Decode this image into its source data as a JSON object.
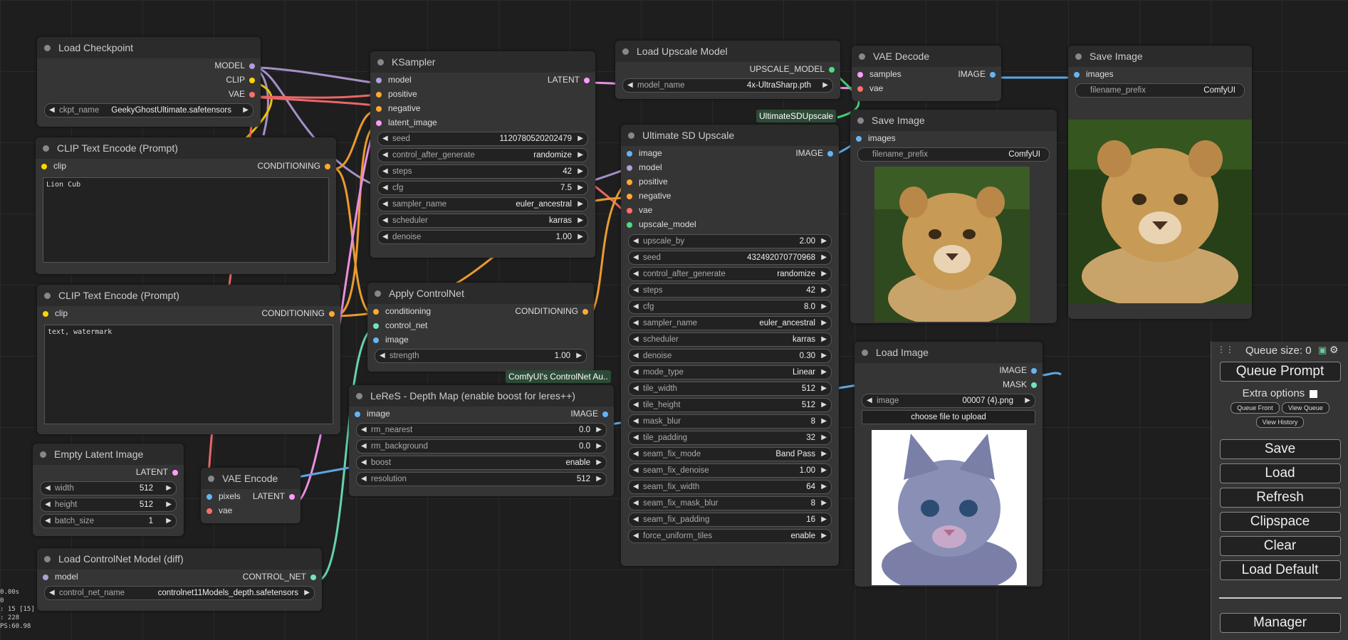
{
  "colors": {
    "model": "#b39ddb",
    "clip": "#ffd500",
    "vae": "#ff6e6e",
    "conditioning": "#ffa931",
    "latent": "#ff9cf9",
    "image": "#64b5f6",
    "control_net": "#6ee7b7",
    "upscale_model": "#4ade80"
  },
  "nodes": {
    "load_checkpoint": {
      "title": "Load Checkpoint",
      "out_model": "MODEL",
      "out_clip": "CLIP",
      "out_vae": "VAE",
      "ckpt_label": "ckpt_name",
      "ckpt_value": "GeekyGhostUltimate.safetensors"
    },
    "clip_pos": {
      "title": "CLIP Text Encode (Prompt)",
      "in_clip": "clip",
      "out": "CONDITIONING",
      "text": "Lion Cub"
    },
    "clip_neg": {
      "title": "CLIP Text Encode (Prompt)",
      "in_clip": "clip",
      "out": "CONDITIONING",
      "text": "text, watermark"
    },
    "empty_latent": {
      "title": "Empty Latent Image",
      "out": "LATENT",
      "widgets": [
        {
          "label": "width",
          "value": "512"
        },
        {
          "label": "height",
          "value": "512"
        },
        {
          "label": "batch_size",
          "value": "1"
        }
      ]
    },
    "vae_encode": {
      "title": "VAE Encode",
      "in_pixels": "pixels",
      "in_vae": "vae",
      "out": "LATENT"
    },
    "load_controlnet": {
      "title": "Load ControlNet Model (diff)",
      "in_model": "model",
      "out": "CONTROL_NET",
      "cn_label": "control_net_name",
      "cn_value": "controlnet11Models_depth.safetensors"
    },
    "ksampler": {
      "title": "KSampler",
      "inputs": [
        "model",
        "positive",
        "negative",
        "latent_image"
      ],
      "out": "LATENT",
      "widgets": [
        {
          "label": "seed",
          "value": "1120780520202479"
        },
        {
          "label": "control_after_generate",
          "value": "randomize"
        },
        {
          "label": "steps",
          "value": "42"
        },
        {
          "label": "cfg",
          "value": "7.5"
        },
        {
          "label": "sampler_name",
          "value": "euler_ancestral"
        },
        {
          "label": "scheduler",
          "value": "karras"
        },
        {
          "label": "denoise",
          "value": "1.00"
        }
      ]
    },
    "apply_controlnet": {
      "title": "Apply ControlNet",
      "inputs": [
        "conditioning",
        "control_net",
        "image"
      ],
      "out": "CONDITIONING",
      "strength_label": "strength",
      "strength_value": "1.00",
      "badge": "ComfyUI's ControlNet Au.."
    },
    "leres": {
      "title": "LeReS - Depth Map (enable boost for leres++)",
      "in_image": "image",
      "out": "IMAGE",
      "widgets": [
        {
          "label": "rm_nearest",
          "value": "0.0"
        },
        {
          "label": "rm_background",
          "value": "0.0"
        },
        {
          "label": "boost",
          "value": "enable"
        },
        {
          "label": "resolution",
          "value": "512"
        }
      ]
    },
    "load_upscale": {
      "title": "Load Upscale Model",
      "out": "UPSCALE_MODEL",
      "model_label": "model_name",
      "model_value": "4x-UltraSharp.pth"
    },
    "ultimate": {
      "title": "Ultimate SD Upscale",
      "inputs": [
        "image",
        "model",
        "positive",
        "negative",
        "vae",
        "upscale_model"
      ],
      "out": "IMAGE",
      "badge": "UltimateSDUpscale",
      "widgets": [
        {
          "label": "upscale_by",
          "value": "2.00"
        },
        {
          "label": "seed",
          "value": "432492070770968"
        },
        {
          "label": "control_after_generate",
          "value": "randomize"
        },
        {
          "label": "steps",
          "value": "42"
        },
        {
          "label": "cfg",
          "value": "8.0"
        },
        {
          "label": "sampler_name",
          "value": "euler_ancestral"
        },
        {
          "label": "scheduler",
          "value": "karras"
        },
        {
          "label": "denoise",
          "value": "0.30"
        },
        {
          "label": "mode_type",
          "value": "Linear"
        },
        {
          "label": "tile_width",
          "value": "512"
        },
        {
          "label": "tile_height",
          "value": "512"
        },
        {
          "label": "mask_blur",
          "value": "8"
        },
        {
          "label": "tile_padding",
          "value": "32"
        },
        {
          "label": "seam_fix_mode",
          "value": "Band Pass"
        },
        {
          "label": "seam_fix_denoise",
          "value": "1.00"
        },
        {
          "label": "seam_fix_width",
          "value": "64"
        },
        {
          "label": "seam_fix_mask_blur",
          "value": "8"
        },
        {
          "label": "seam_fix_padding",
          "value": "16"
        },
        {
          "label": "force_uniform_tiles",
          "value": "enable"
        }
      ]
    },
    "vae_decode": {
      "title": "VAE Decode",
      "in_samples": "samples",
      "in_vae": "vae",
      "out": "IMAGE"
    },
    "save_image_1": {
      "title": "Save Image",
      "in": "images",
      "prefix_label": "filename_prefix",
      "prefix_value": "ComfyUI"
    },
    "save_image_2": {
      "title": "Save Image",
      "in": "images",
      "prefix_label": "filename_prefix",
      "prefix_value": "ComfyUI"
    },
    "load_image": {
      "title": "Load Image",
      "out_image": "IMAGE",
      "out_mask": "MASK",
      "image_label": "image",
      "image_value": "00007 (4).png",
      "upload": "choose file to upload"
    }
  },
  "panel": {
    "queue_size": "Queue size: 0",
    "queue_prompt": "Queue Prompt",
    "extra_options": "Extra options",
    "queue_front": "Queue Front",
    "view_queue": "View Queue",
    "view_history": "View History",
    "save": "Save",
    "load": "Load",
    "refresh": "Refresh",
    "clipspace": "Clipspace",
    "clear": "Clear",
    "load_default": "Load Default",
    "manager": "Manager"
  },
  "stats": [
    "0.00s",
    "0",
    ": 15 [15]",
    ": 228",
    "PS:60.98"
  ]
}
